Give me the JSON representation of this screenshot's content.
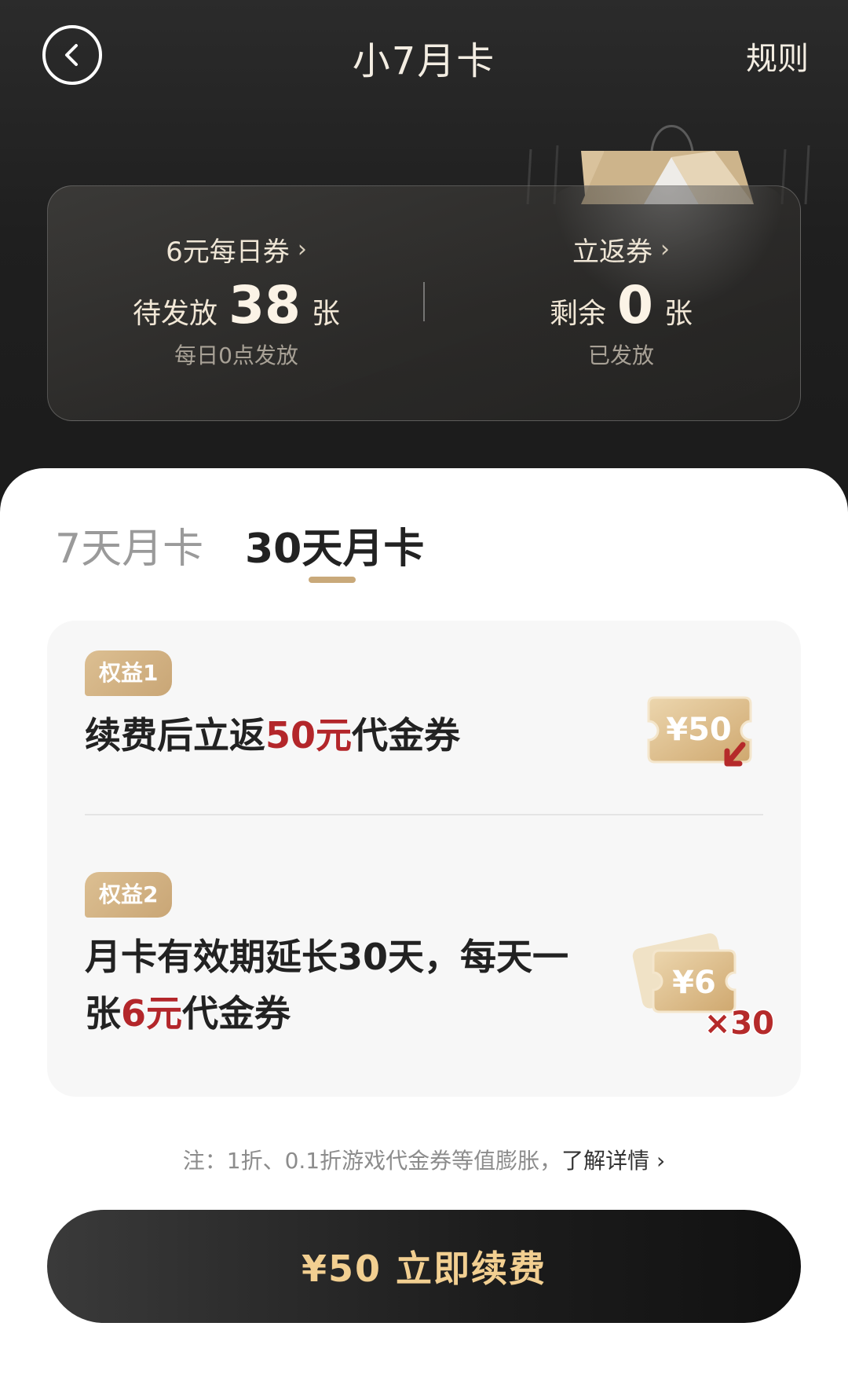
{
  "header": {
    "title": "小7月卡",
    "rules_label": "规则"
  },
  "stats": {
    "left": {
      "link_label": "6元每日券",
      "prefix": "待发放",
      "count": "38",
      "unit": "张",
      "sub": "每日0点发放"
    },
    "right": {
      "link_label": "立返券",
      "prefix": "剩余",
      "count": "0",
      "unit": "张",
      "sub": "已发放"
    }
  },
  "tabs": [
    {
      "label": "7天月卡",
      "selected": false
    },
    {
      "label": "30天月卡",
      "selected": true
    }
  ],
  "benefits": [
    {
      "badge": "权益1",
      "text_before": "续费后立返",
      "highlight": "50元",
      "text_after": "代金券",
      "icon_label": "¥50"
    },
    {
      "badge": "权益2",
      "text_before": "月卡有效期延长30天，每天一张",
      "highlight": "6元",
      "text_after": "代金券",
      "icon_label": "¥6",
      "icon_multiplier": "×30"
    }
  ],
  "note": {
    "text": "注：1折、0.1折游戏代金券等值膨胀，",
    "link": "了解详情"
  },
  "cta": {
    "label": "¥50 立即续费"
  },
  "colors": {
    "accent_gold": "#c9a97a",
    "highlight_red": "#b3262a",
    "cta_text": "#f2cf91"
  },
  "icons": [
    "back-icon",
    "chevron-right-icon",
    "coupon-50-icon",
    "coupon-stack-icon"
  ]
}
